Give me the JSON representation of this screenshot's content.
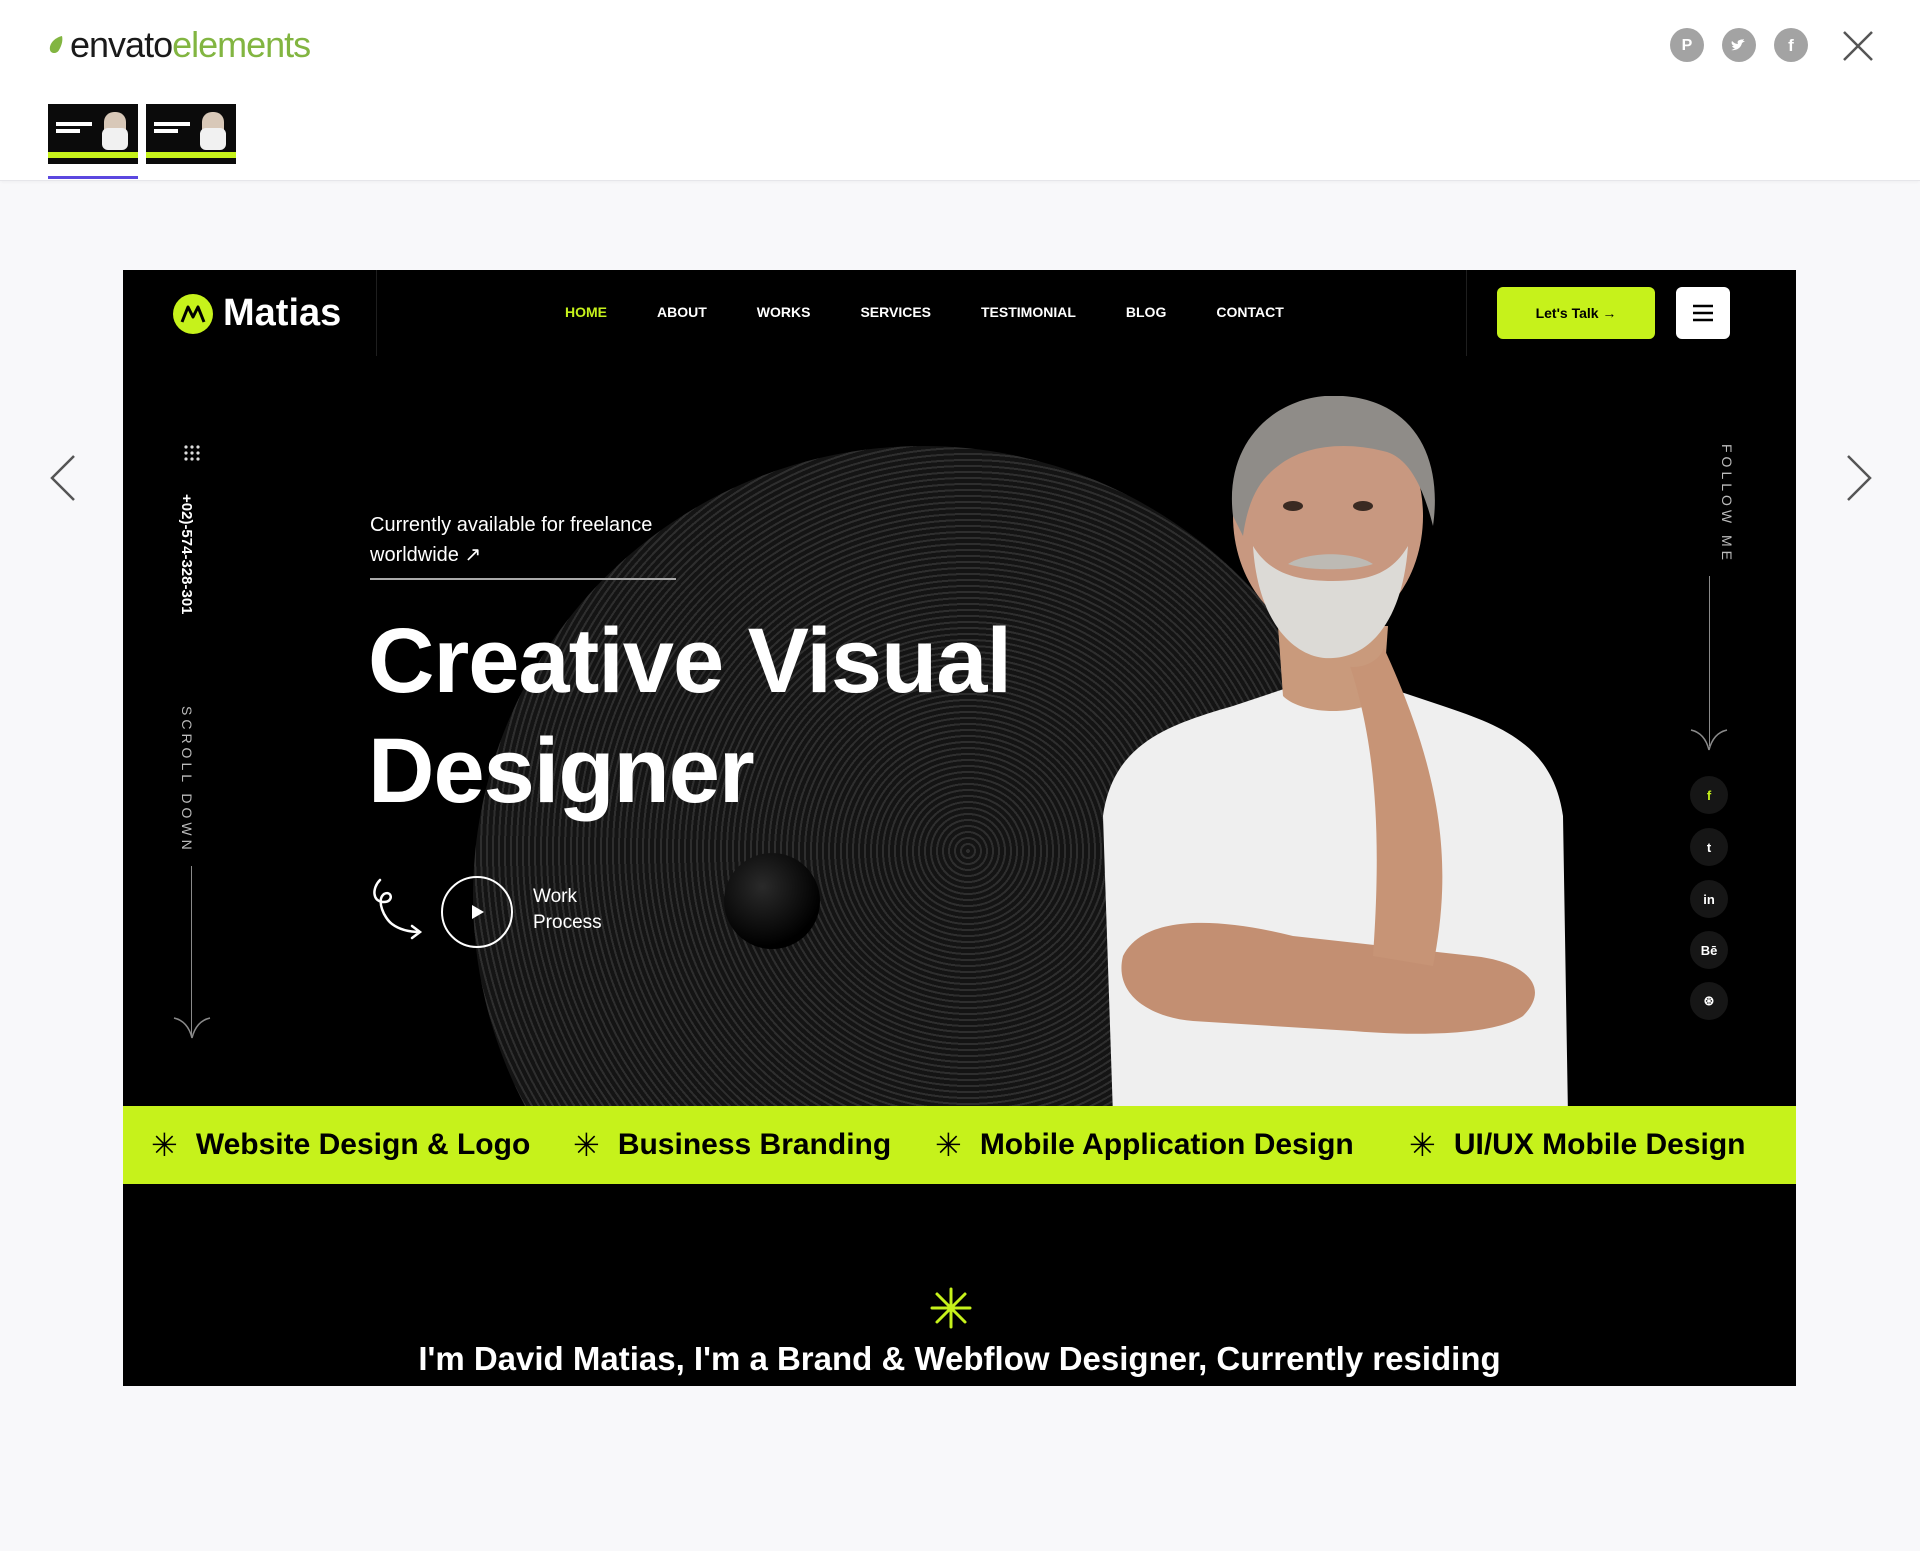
{
  "header": {
    "logo_part1": "envato",
    "logo_part2": "elements",
    "share_icons": [
      "pinterest-icon",
      "twitter-icon",
      "facebook-icon"
    ],
    "close_icon": "close-icon"
  },
  "thumbnails": [
    {
      "selected": true
    },
    {
      "selected": false
    }
  ],
  "preview": {
    "brand": "Matias",
    "menu": [
      "HOME",
      "ABOUT",
      "WORKS",
      "SERVICES",
      "TESTIMONIAL",
      "BLOG",
      "CONTACT"
    ],
    "cta": "Let's Talk →",
    "phone": "+02)-574-328-301",
    "scroll_label": "SCROLL DOWN",
    "follow_label": "FOLLOW ME",
    "availability_line1": "Currently available for freelance",
    "availability_line2": "worldwide ↗",
    "headline_line1": "Creative Visual",
    "headline_line2": "Designer",
    "work_line1": "Work",
    "work_line2": "Process",
    "socials": [
      "f",
      "t",
      "in",
      "Bē",
      "⊛"
    ],
    "ticker": [
      "Website Design & Logo",
      "Business Branding",
      "Mobile Application Design",
      "UI/UX Mobile Design"
    ],
    "bio": "I'm David Matias, I'm a Brand & Webflow Designer, Currently residing"
  },
  "colors": {
    "accent": "#c6f21b",
    "envato_green": "#82b541",
    "selection": "#5b47e0"
  }
}
